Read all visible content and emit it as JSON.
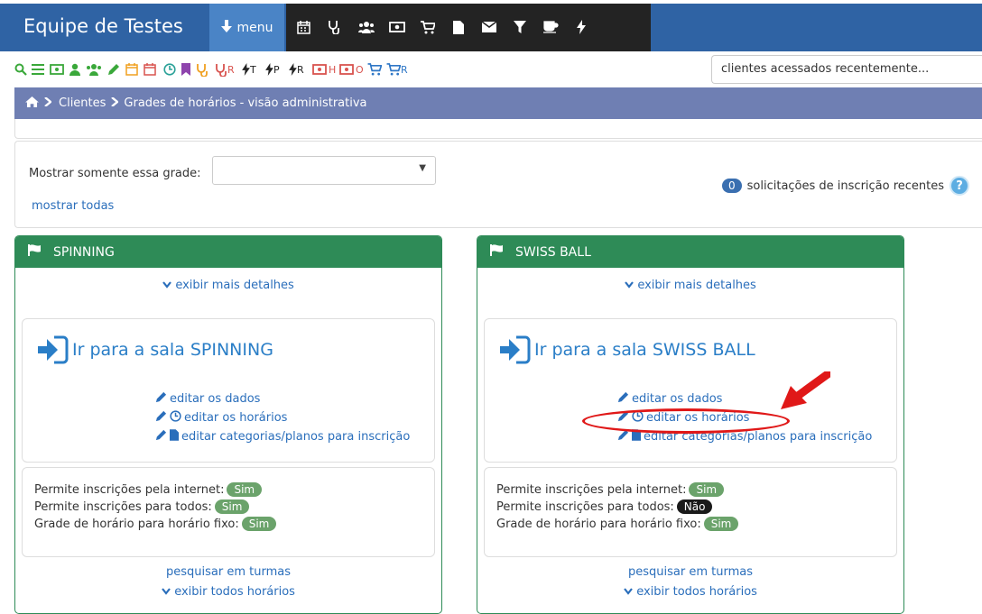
{
  "navbar": {
    "brand": "Equipe de Testes",
    "menu_label": "menu",
    "icons": [
      "calendar-icon",
      "stethoscope-icon",
      "users-icon",
      "money-icon",
      "cart-icon",
      "file-icon",
      "envelope-icon",
      "filter-icon",
      "coffee-icon",
      "bolt-icon"
    ]
  },
  "toolbar": {
    "letters": {
      "r1": "R",
      "t": "T",
      "p": "P",
      "r2": "R",
      "h": "H",
      "o": "O",
      "r3": "R"
    },
    "recent_clients": "clientes acessados recentemente..."
  },
  "breadcrumb": {
    "item1": "Clientes",
    "item2": "Grades de horários - visão administrativa"
  },
  "filter": {
    "label": "Mostrar somente essa grade:",
    "select_value": "",
    "show_all": "mostrar todas",
    "requests_count": "0",
    "requests_text": "solicitações de inscrição recentes",
    "help": "?"
  },
  "cards": [
    {
      "title": "SPINNING",
      "details": "exibir mais detalhes",
      "go_room": "Ir para a sala SPINNING",
      "edit_data": "editar os dados",
      "edit_hours": "editar os horários",
      "edit_categories": "editar categorias/planos para inscrição",
      "internet_label": "Permite inscrições pela internet:",
      "internet_value": "Sim",
      "all_label": "Permite inscrições para todos:",
      "all_value": "Sim",
      "fixed_label": "Grade de horário para horário fixo:",
      "fixed_value": "Sim",
      "search_classes": "pesquisar em turmas",
      "show_all_hours": "exibir todos horários"
    },
    {
      "title": "SWISS BALL",
      "details": "exibir mais detalhes",
      "go_room": "Ir para a sala SWISS BALL",
      "edit_data": "editar os dados",
      "edit_hours": "editar os horários",
      "edit_categories": "editar categorias/planos para inscrição",
      "internet_label": "Permite inscrições pela internet:",
      "internet_value": "Sim",
      "all_label": "Permite inscrições para todos:",
      "all_value": "Não",
      "fixed_label": "Grade de horário para horário fixo:",
      "fixed_value": "Sim",
      "search_classes": "pesquisar em turmas",
      "show_all_hours": "exibir todos horários"
    }
  ],
  "colors": {
    "navbar": "#2f63a4",
    "menu": "#4a84c6",
    "card_header": "#2e8b57",
    "breadcrumb": "#6f7fb3",
    "annotation": "#e01818"
  }
}
